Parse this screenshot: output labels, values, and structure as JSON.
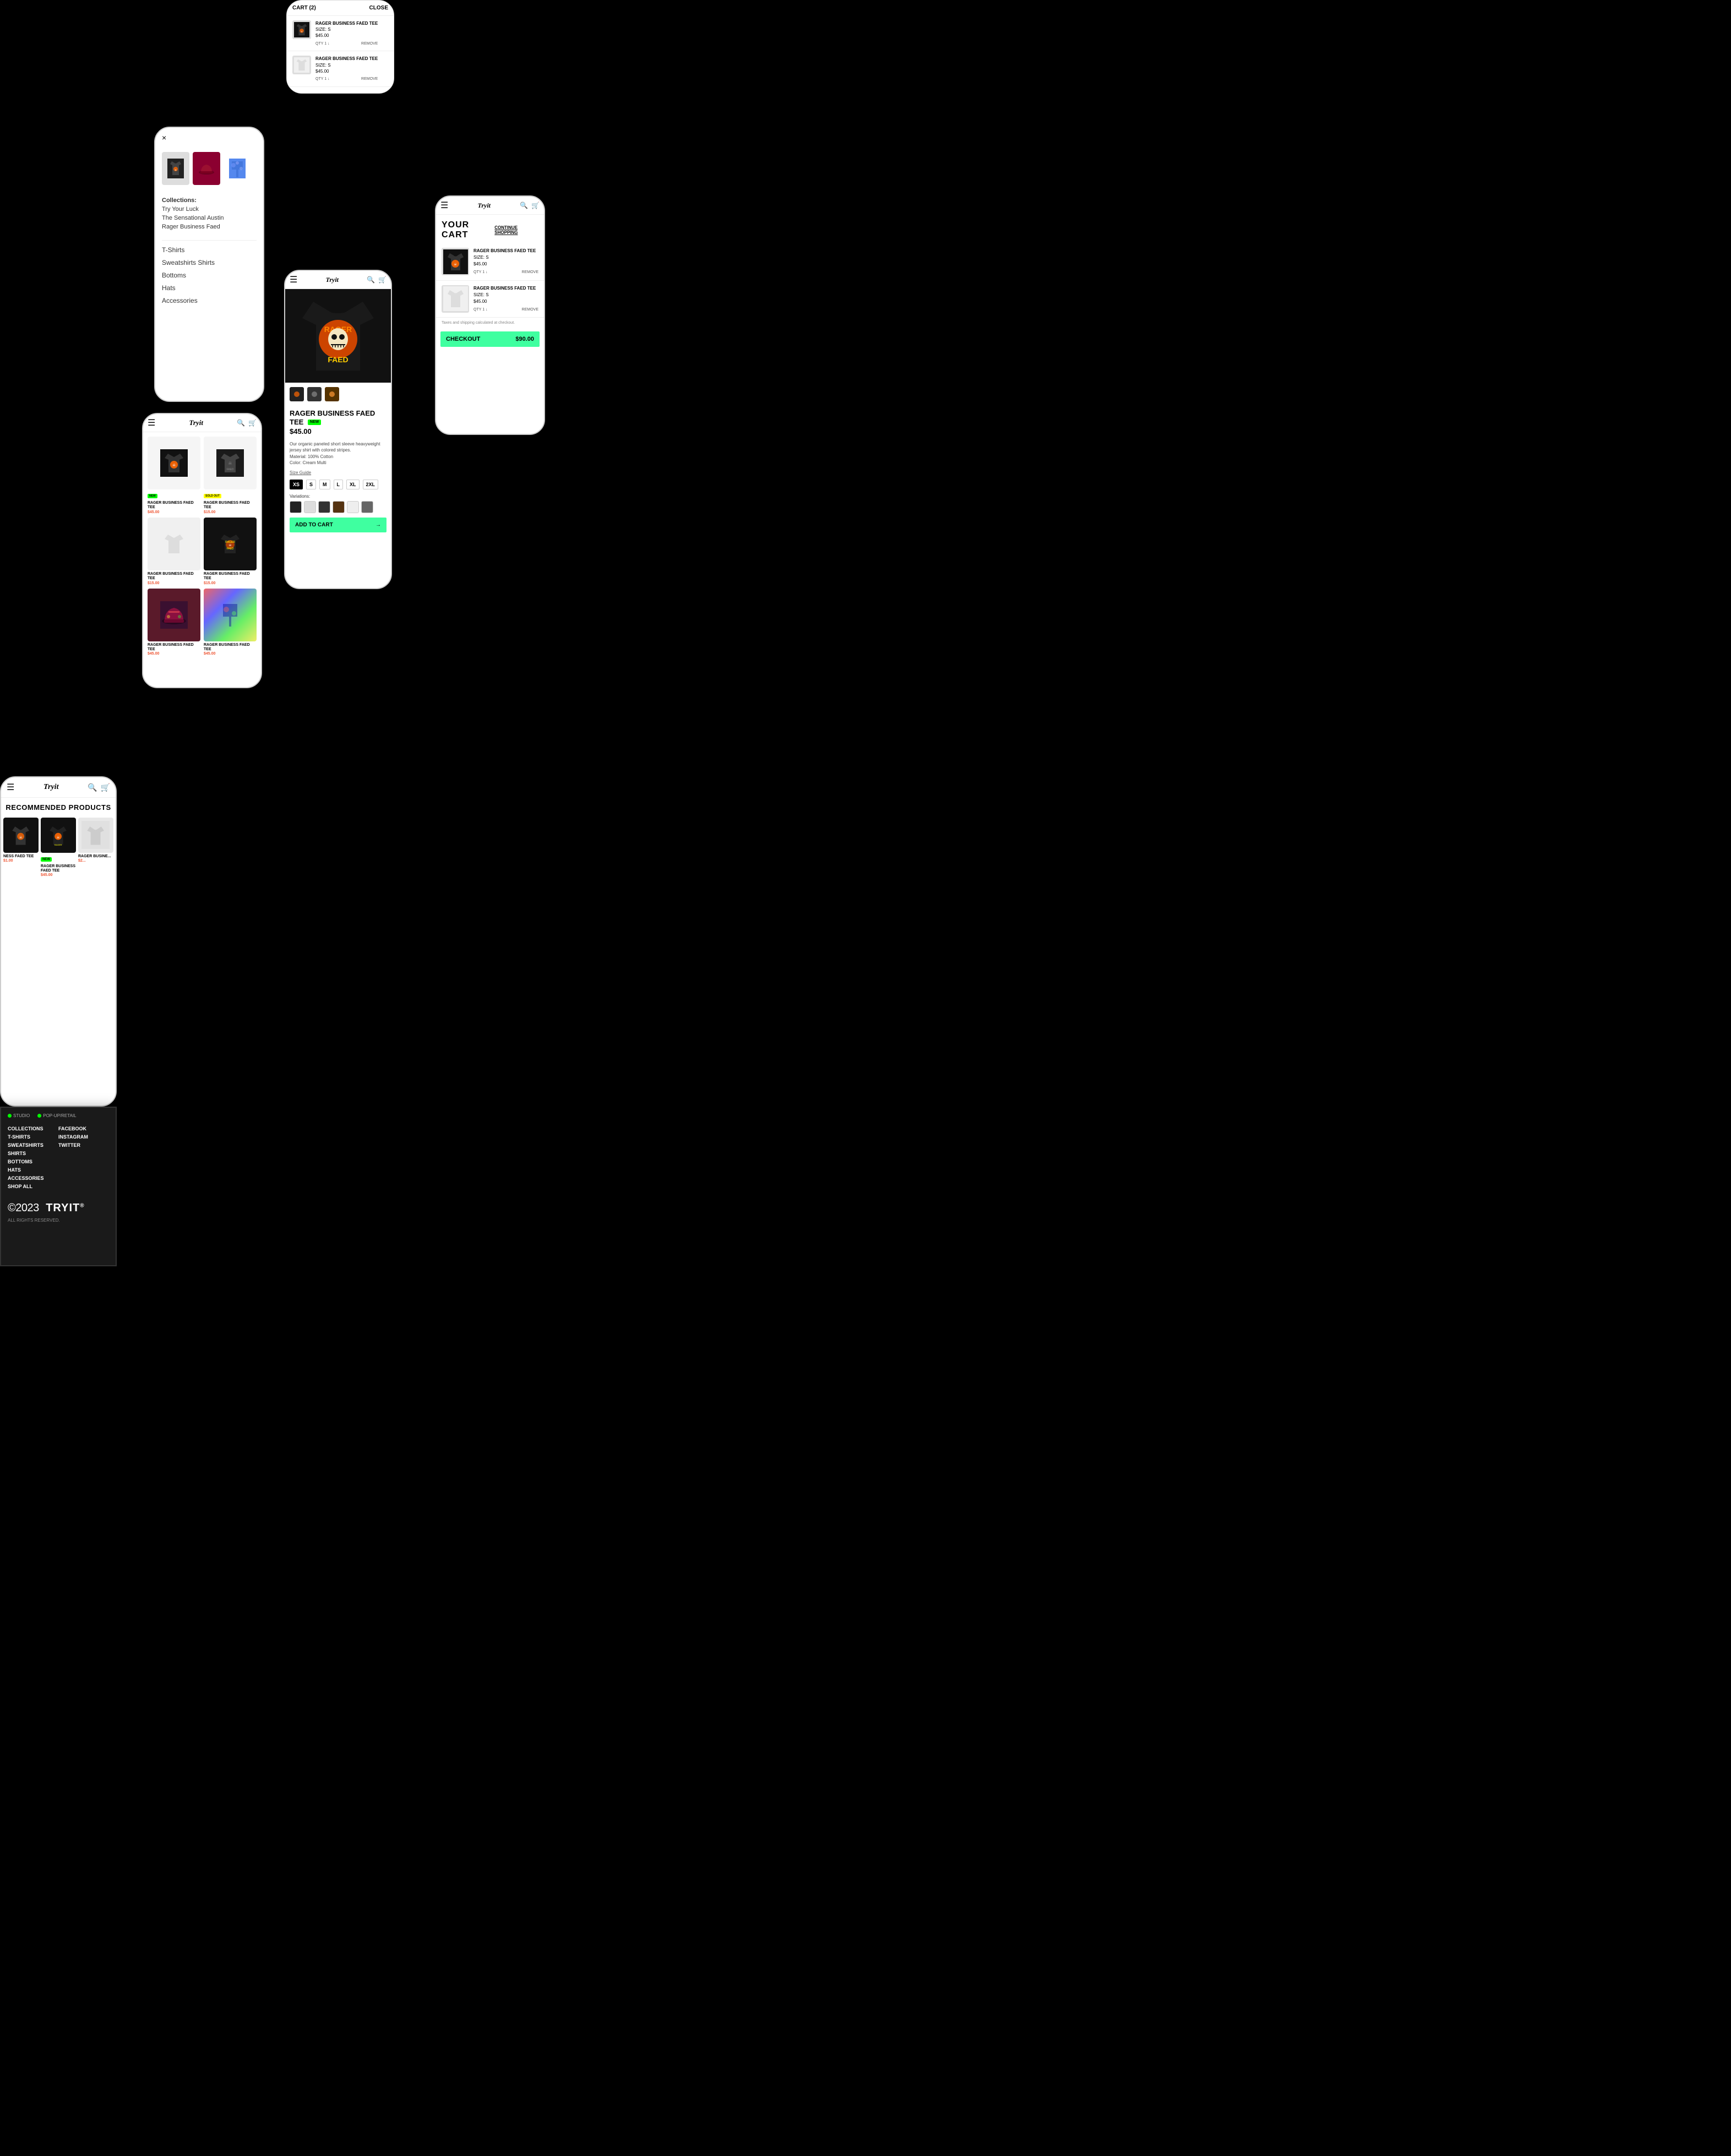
{
  "site": {
    "logo": "Tryit",
    "logo_italic": true
  },
  "panel_recommended": {
    "title": "RECOMMENDED PRODUCTS",
    "products": [
      {
        "name": "NESS FAED TEE",
        "price": "$1.00",
        "badge": "",
        "type": "dark"
      },
      {
        "name": "RAGER BUSINESS FAED TEE",
        "price": "$45.00",
        "badge": "NEW",
        "type": "dark"
      },
      {
        "name": "RAGER BUSINE...",
        "price": "$2...",
        "badge": "",
        "type": "light"
      }
    ]
  },
  "panel_footer": {
    "studio_link": "STUDIO",
    "popup_link": "POP-UP/RETAIL",
    "nav_col1": [
      "COLLECTIONS",
      "T-SHIRTS",
      "SWEATSHIRTS",
      "SHIRTS",
      "BOTTOMS",
      "HATS",
      "ACCESSORIES",
      "SHOP ALL"
    ],
    "nav_col2": [
      "FACEBOOK",
      "INSTAGRAM",
      "TWITTER"
    ],
    "copyright_year": "©2023",
    "copyright_brand": "TRYIT",
    "trademark": "®",
    "rights": "ALL RIGHTS RESERVED."
  },
  "panel_collections": {
    "close_label": "×",
    "sections_heading": "Collections:",
    "collections": [
      "Try Your Luck",
      "The Sensational Austin",
      "Rager Business Faed"
    ],
    "categories": [
      "T-Shirts",
      "Sweatshirts Shirts",
      "Bottoms",
      "Hats",
      "Accessories"
    ]
  },
  "panel_grid": {
    "items": [
      {
        "name": "RAGER BUSINESS FAED TEE",
        "price": "$45.00",
        "badge": "NEW"
      },
      {
        "name": "RAGER BUSINESS FAED TEE",
        "price": "$15.00",
        "badge": "SOLD OUT"
      },
      {
        "name": "RAGER BUSINESS FAED TEE",
        "price": "$15.00",
        "badge": ""
      },
      {
        "name": "RAGER BUSINESS FAED TEE",
        "price": "$15.00",
        "badge": ""
      },
      {
        "name": "RAGER BUSINESS FAED TEE",
        "price": "$45.00",
        "badge": ""
      },
      {
        "name": "RAGER BUSINESS FAED TEE",
        "price": "$45.00",
        "badge": ""
      }
    ]
  },
  "panel_cart": {
    "title": "CART (2)",
    "close_label": "CLOSE",
    "items": [
      {
        "name": "RAGER BUSINESS FAED TEE",
        "size": "SIZE: S",
        "price": "$45.00",
        "qty": "QTY 1 ↓",
        "remove": "REMOVE"
      },
      {
        "name": "RAGER BUSINESS FAED TEE",
        "size": "SIZE: S",
        "price": "$45.00",
        "qty": "QTY 1 ↓",
        "remove": "REMOVE"
      }
    ],
    "checkout_label": "CHECKOUT",
    "checkout_total": "$90.00"
  },
  "panel_product": {
    "title": "RAGER BUSINESS FAED TEE",
    "badge": "NEW",
    "price": "$45.00",
    "description": "Our organic paneled short sleeve heavyweight jersey shirt with colored stripes.",
    "material": "Material: 100% Cotton",
    "color": "Color: Cream Multi",
    "size_guide": "Size Guide",
    "sizes": [
      "XS",
      "S",
      "M",
      "L",
      "XL",
      "2XL"
    ],
    "selected_size": "XS",
    "variations_label": "Variations:",
    "add_to_cart": "ADD TO CART",
    "arrow": "→"
  },
  "panel_fullcart": {
    "title": "YOUR CART",
    "continue_label": "CONTINUE SHOPPING",
    "items": [
      {
        "name": "RAGER BUSINESS FAED TEE",
        "size": "SIZE: S",
        "price": "$45.00",
        "qty": "QTY 1 ↓",
        "remove": "REMOVE"
      },
      {
        "name": "RAGER BUSINESS FAED TEE",
        "size": "SIZE: S",
        "price": "$45.00",
        "qty": "QTY 1 ↓",
        "remove": "REMOVE"
      }
    ],
    "tax_note": "Taxes and shipping calculated at checkout.",
    "checkout_label": "CHECKOUT",
    "checkout_total": "$90.00"
  }
}
